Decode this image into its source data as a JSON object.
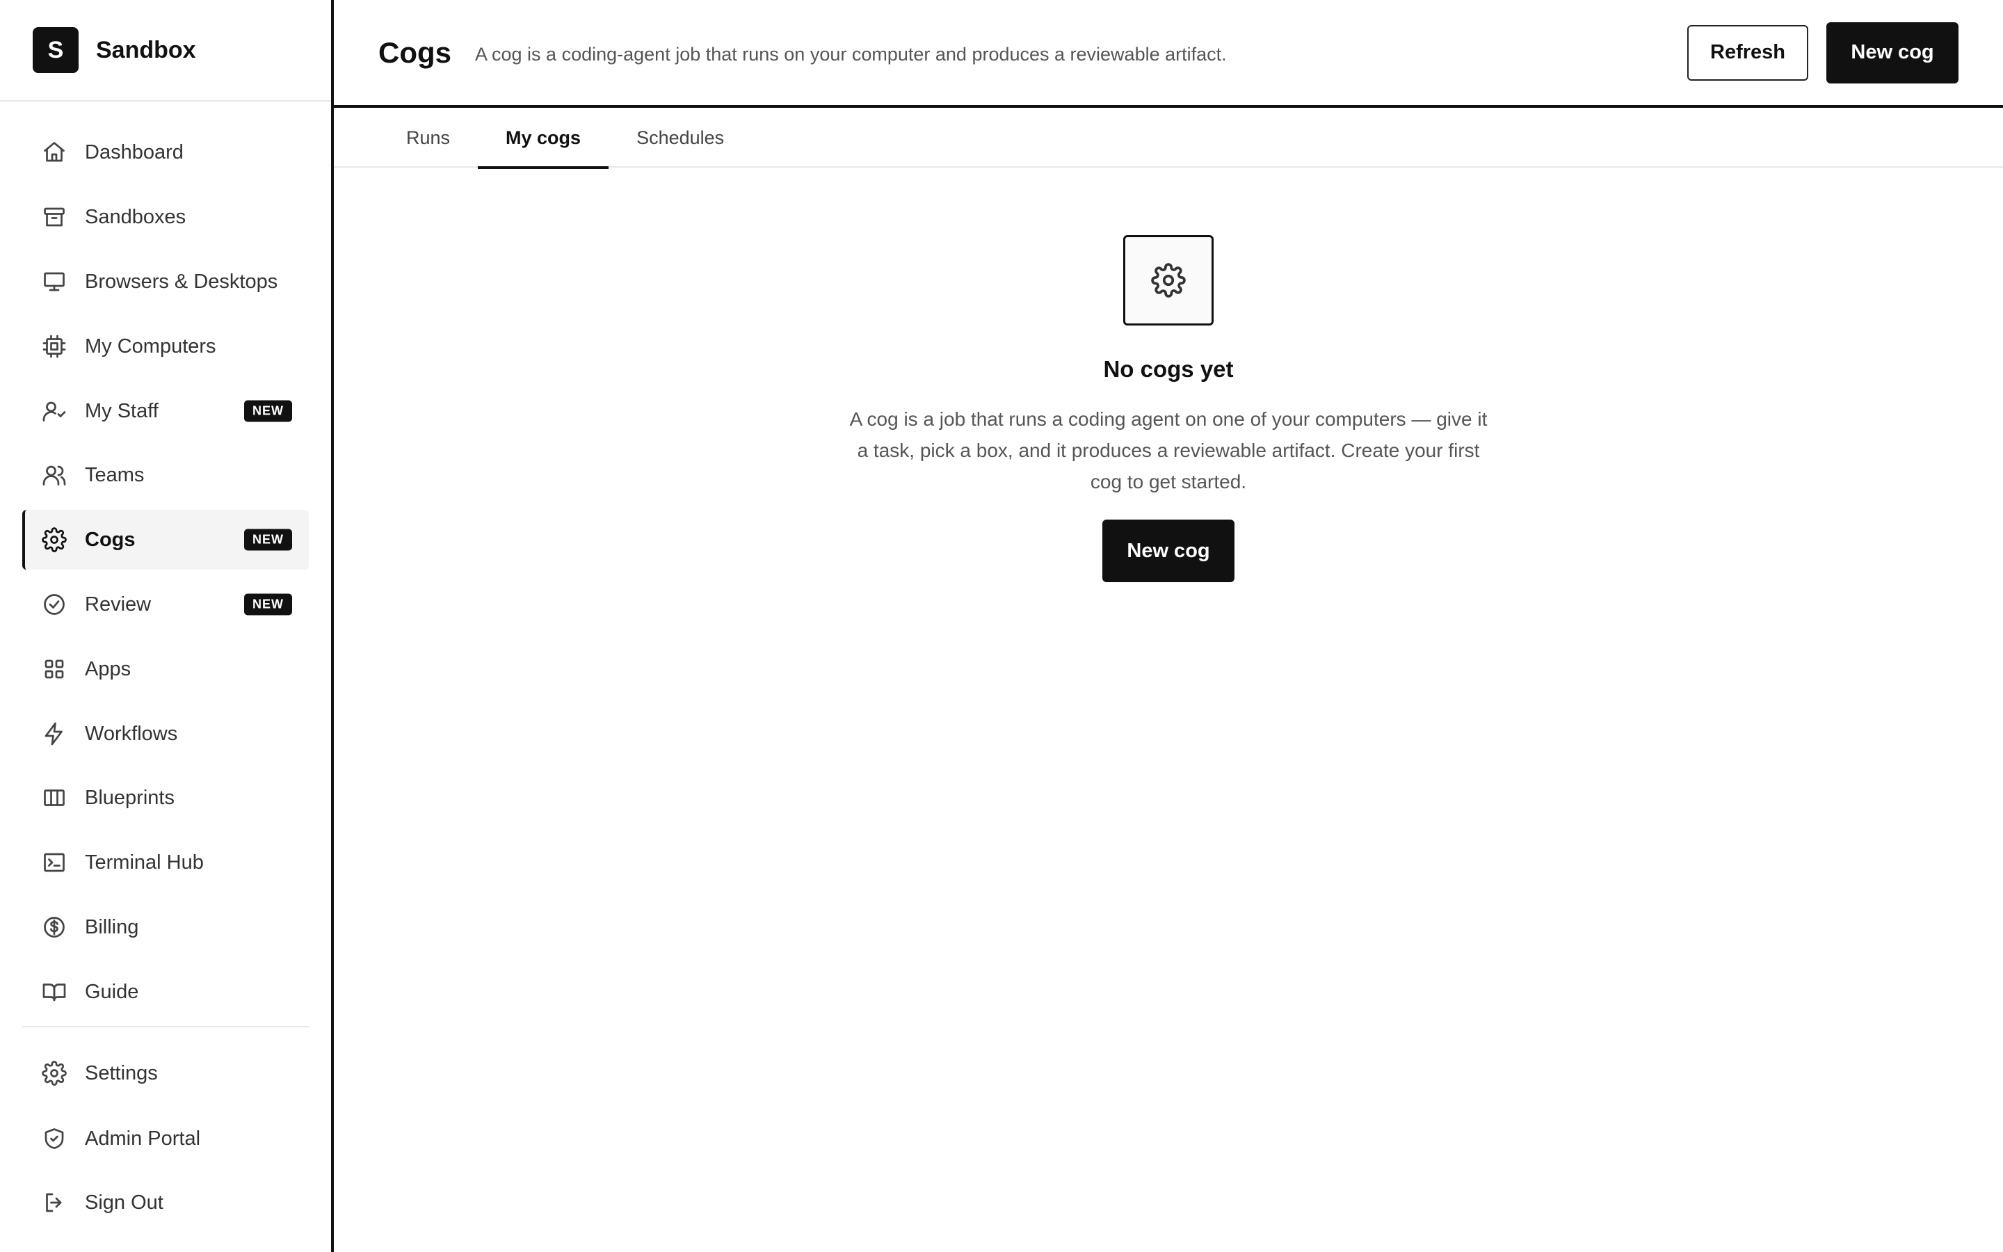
{
  "brand": {
    "logo_letter": "S",
    "name": "Sandbox"
  },
  "sidebar": {
    "items": [
      {
        "label": "Dashboard",
        "icon": "home-icon"
      },
      {
        "label": "Sandboxes",
        "icon": "archive-icon"
      },
      {
        "label": "Browsers & Desktops",
        "icon": "monitor-icon"
      },
      {
        "label": "My Computers",
        "icon": "cpu-icon"
      },
      {
        "label": "My Staff",
        "icon": "staff-icon",
        "badge": "NEW"
      },
      {
        "label": "Teams",
        "icon": "users-icon"
      },
      {
        "label": "Cogs",
        "icon": "gear-icon",
        "badge": "NEW",
        "active": true
      },
      {
        "label": "Review",
        "icon": "check-circle-icon",
        "badge": "NEW"
      },
      {
        "label": "Apps",
        "icon": "grid-icon"
      },
      {
        "label": "Workflows",
        "icon": "bolt-icon"
      },
      {
        "label": "Blueprints",
        "icon": "columns-icon"
      },
      {
        "label": "Terminal Hub",
        "icon": "terminal-icon"
      },
      {
        "label": "Billing",
        "icon": "dollar-icon"
      },
      {
        "label": "Guide",
        "icon": "book-icon"
      }
    ],
    "footer_items": [
      {
        "label": "Settings",
        "icon": "gear-icon"
      },
      {
        "label": "Admin Portal",
        "icon": "shield-icon"
      },
      {
        "label": "Sign Out",
        "icon": "logout-icon"
      }
    ]
  },
  "header": {
    "title": "Cogs",
    "subtitle": "A cog is a coding-agent job that runs on your computer and produces a reviewable artifact.",
    "refresh_label": "Refresh",
    "new_cog_label": "New cog"
  },
  "tabs": [
    {
      "label": "Runs"
    },
    {
      "label": "My cogs",
      "active": true
    },
    {
      "label": "Schedules"
    }
  ],
  "empty_state": {
    "icon": "gear-icon",
    "title": "No cogs yet",
    "description": "A cog is a job that runs a coding agent on one of your computers — give it a task, pick a box, and it produces a reviewable artifact. Create your first cog to get started.",
    "button_label": "New cog"
  },
  "colors": {
    "primary": "#111111",
    "text_muted": "#555555",
    "active_bg": "#f4f4f4"
  }
}
